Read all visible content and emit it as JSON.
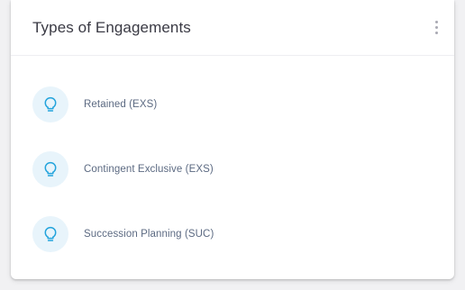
{
  "card": {
    "title": "Types of Engagements",
    "menu_icon": "kebab-vertical-icon"
  },
  "engagements": [
    {
      "label": "Retained (EXS)",
      "icon": "lightbulb-icon"
    },
    {
      "label": "Contingent Exclusive (EXS)",
      "icon": "lightbulb-icon"
    },
    {
      "label": "Succession Planning (SUC)",
      "icon": "lightbulb-icon"
    }
  ],
  "colors": {
    "icon_stroke": "#22a3dc",
    "icon_background": "#e8f4fb"
  }
}
